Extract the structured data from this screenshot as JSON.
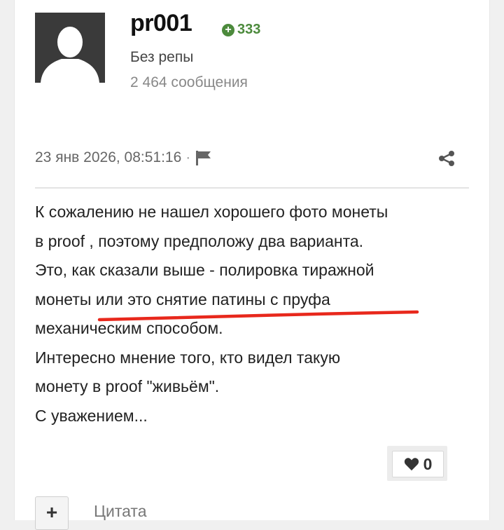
{
  "user": {
    "name": "pr001",
    "reputation": "333",
    "rank": "Без репы",
    "posts": "2 464 сообщения"
  },
  "post": {
    "timestamp": "23 янв 2026, 08:51:16",
    "separator": "·",
    "lines": [
      "К сожалению не нашел хорошего фото монеты",
      "в proof , поэтому предположу два варианта.",
      "Это, как сказали выше - полировка тиражной",
      "монеты или это снятие патины с пруфа",
      "механическим способом.",
      "Интересно мнение того, кто видел такую",
      "монету в proof \"живьём\".",
      "С уважением..."
    ],
    "likes": "0"
  },
  "footer": {
    "plus_label": "+",
    "quote_label": "Цитата"
  },
  "colors": {
    "reputation": "#4c8a3c",
    "annotation": "#e8281c"
  }
}
